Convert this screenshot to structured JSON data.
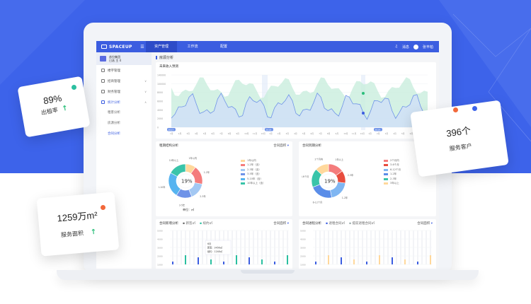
{
  "app": {
    "logo": "SPACEUP"
  },
  "topnav": {
    "items": [
      "资产管理",
      "工作流",
      "配置"
    ],
    "notify": "消息",
    "user": "张丰柏"
  },
  "sidebar": {
    "org_name": "苏拉集团",
    "org_sub": "已选 主 4",
    "menu": [
      {
        "label": "楼宇管理",
        "has_children": false
      },
      {
        "label": "招商管理",
        "has_children": true
      },
      {
        "label": "财务管理",
        "has_children": true
      },
      {
        "label": "统计分析",
        "has_children": true
      }
    ],
    "submenu": [
      "租客分析",
      "房源分析",
      "合同分析"
    ]
  },
  "page": {
    "title": "房源分析"
  },
  "forecast": {
    "title": "未来收入预测",
    "chart_data": {
      "type": "area",
      "y_ticks": [
        "140000",
        "100000",
        "8000",
        "6000",
        "4000",
        "2000",
        "0"
      ],
      "x_ticks": [
        "1月",
        "2月",
        "3月",
        "4月",
        "5月",
        "6月",
        "7月",
        "8月",
        "9月",
        "10月",
        "11月",
        "12月",
        "1月",
        "2月",
        "3月",
        "4月",
        "5月",
        "6月",
        "7月",
        "8月",
        "9月",
        "10月",
        "11月",
        "12月",
        "1月",
        "2月",
        "3月",
        "4月",
        "5月",
        "6月",
        "7月",
        "8月"
      ],
      "markers": [
        "2017",
        "2018",
        "2019"
      ]
    }
  },
  "lease_structure": {
    "title": "租期结构分析",
    "filter": "合同面积",
    "center": "19%",
    "unit": "单位：㎡",
    "slice_labels": [
      "1年以内",
      "1-2年",
      "2-3年",
      "3-5年",
      "5-10年",
      "10年以上"
    ],
    "legend": [
      "1年以内",
      "1-2年（含）",
      "2-3年（含）",
      "3-5年（含）",
      "5-10年（含）",
      "10年以上（含）"
    ],
    "chart_data": {
      "type": "pie",
      "labels": [
        "1年以内",
        "1-2年",
        "2-3年",
        "3-5年",
        "5-10年",
        "10年以上"
      ],
      "values": [
        10,
        18,
        16,
        15,
        24,
        17
      ],
      "colors": [
        "#ffd89c",
        "#f47c7c",
        "#a3c8f3",
        "#6f93e8",
        "#56b4f0",
        "#39c4a9"
      ]
    }
  },
  "contract_expiry": {
    "title": "合同到期分析",
    "filter": "合同面积",
    "center": "19%",
    "slice_labels": [
      "1年以上",
      "2-3年",
      "1-2年",
      "6-12个月",
      "3-6个月",
      "2个月内"
    ],
    "legend": [
      "2个月内",
      "3-6个月",
      "6-12个月",
      "1-2年",
      "2-3年",
      "3年以上"
    ],
    "chart_data": {
      "type": "pie",
      "labels": [
        "2个月内",
        "3-6个月",
        "6-12个月",
        "1-2年",
        "2-3年",
        "3年以上"
      ],
      "values": [
        15,
        12,
        20,
        22,
        18,
        13
      ],
      "colors": [
        "#f47c7c",
        "#e84c3d",
        "#7fb6f2",
        "#5a8de8",
        "#39c4a9",
        "#ffd89c"
      ]
    }
  },
  "contract_added": {
    "title": "合同新增分析",
    "legend": [
      "新签㎡",
      "续约㎡"
    ],
    "filter": "合同面积",
    "y_ticks": [
      "5000",
      "4000",
      "3000",
      "2000",
      "1000"
    ],
    "tooltip": {
      "month": "6月",
      "line1": "新签：3456㎡",
      "line2": "续约：1248㎡"
    }
  },
  "contract_progress": {
    "title": "合同进程分析",
    "legend": [
      "退租合同㎡",
      "提前退租合同㎡"
    ],
    "filter": "合同面积",
    "y_ticks": [
      "5000",
      "4000",
      "3000",
      "2000",
      "1000"
    ]
  },
  "stats": {
    "occupancy": {
      "value": "89%",
      "label": "出租率"
    },
    "area": {
      "value": "1259万m²",
      "label": "服务面积"
    },
    "clients": {
      "value": "396个",
      "label": "服务客户"
    }
  },
  "colors": {
    "brand": "#3b5de0",
    "background": "#3d63ea",
    "up": "#2bbf7a",
    "dot_orange": "#f2683a",
    "dot_teal": "#2bbfa0",
    "dot_blue": "#3d63ea"
  }
}
